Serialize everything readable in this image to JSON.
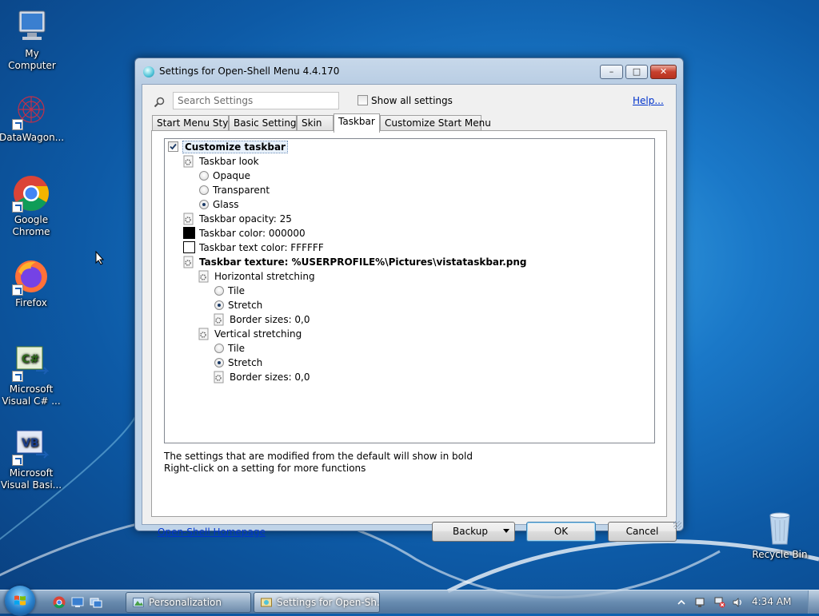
{
  "desktop": {
    "icons": [
      {
        "label": "My Computer",
        "icon": "computer-icon"
      },
      {
        "label": "DataWagon...",
        "icon": "datawagon-icon"
      },
      {
        "label": "Google Chrome",
        "icon": "chrome-icon"
      },
      {
        "label": "Firefox",
        "icon": "firefox-icon"
      },
      {
        "label": "Microsoft Visual C# ...",
        "icon": "visual-csharp-icon"
      },
      {
        "label": "Microsoft Visual Basi...",
        "icon": "visual-basic-icon"
      },
      {
        "label": "Recycle Bin",
        "icon": "recycle-bin-icon"
      }
    ]
  },
  "window": {
    "title": "Settings for Open-Shell Menu 4.4.170",
    "search_placeholder": "Search Settings",
    "show_all_label": "Show all settings",
    "show_all_checked": false,
    "help_label": "Help...",
    "tabs": [
      {
        "label": "Start Menu Style"
      },
      {
        "label": "Basic Settings"
      },
      {
        "label": "Skin"
      },
      {
        "label": "Taskbar",
        "active": true
      },
      {
        "label": "Customize Start Menu"
      }
    ],
    "tree": {
      "customize_taskbar": "Customize taskbar",
      "taskbar_look": "Taskbar look",
      "opaque": "Opaque",
      "transparent": "Transparent",
      "glass": "Glass",
      "selected_look": "Glass",
      "opacity": "Taskbar opacity: 25",
      "color": "Taskbar color: 000000",
      "text_color": "Taskbar text color: FFFFFF",
      "texture": "Taskbar texture: %USERPROFILE%\\Pictures\\vistataskbar.png",
      "horizontal_stretching": "Horizontal stretching",
      "h_tile": "Tile",
      "h_stretch": "Stretch",
      "h_border": "Border sizes: 0,0",
      "vertical_stretching": "Vertical stretching",
      "v_tile": "Tile",
      "v_stretch": "Stretch",
      "v_border": "Border sizes: 0,0"
    },
    "info_line1": "The settings that are modified from the default will show in bold",
    "info_line2": "Right-click on a setting for more functions",
    "homepage_label": "Open-Shell Homepage",
    "backup_label": "Backup",
    "ok_label": "OK",
    "cancel_label": "Cancel",
    "colors": {
      "taskbar_color": "#000000",
      "taskbar_text_color": "#FFFFFF"
    }
  },
  "taskbar": {
    "buttons": [
      {
        "label": "Personalization",
        "icon": "personalization-icon"
      },
      {
        "label": "Settings for Open-Sh...",
        "icon": "open-shell-icon",
        "active": true
      }
    ],
    "clock": "4:34 AM"
  }
}
